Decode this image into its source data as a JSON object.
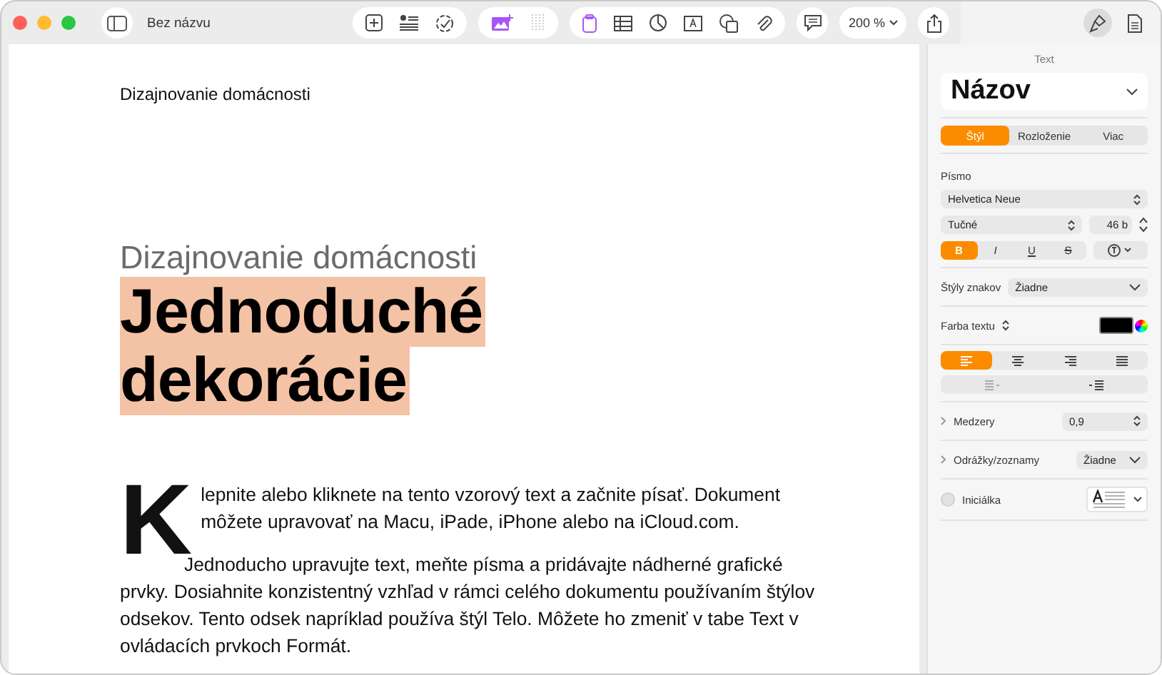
{
  "window": {
    "title": "Bez názvu"
  },
  "toolbar": {
    "zoom": "200 %",
    "inspector_tabs": [
      {
        "kind": "format",
        "selected": true
      },
      {
        "kind": "document",
        "selected": false
      }
    ]
  },
  "document": {
    "header": "Dizajnovanie domácnosti",
    "subtitle": "Dizajnovanie domácnosti",
    "title_lines": [
      "Jednoduché",
      "dekorácie"
    ],
    "drop_cap": "K",
    "paragraphs": [
      "lepnite alebo kliknete na tento vzorový text a začnite písať. Dokument môžete upravovať na Macu, iPade, iPhone alebo na iCloud.com.",
      "Jednoducho upravujte text, meňte písma a pridávajte nádherné grafické prvky. Dosiahnite konzistentný vzhľad v rámci celého dokumentu používaním štýlov odsekov. Tento odsek napríklad používa štýl Telo. Môžete ho zmeniť v tabe Text v ovládacích prvkoch Formát."
    ]
  },
  "sidebar": {
    "heading": "Text",
    "paragraph_style": "Názov",
    "tabs": [
      {
        "label": "Štýl",
        "selected": true
      },
      {
        "label": "Rozloženie",
        "selected": false
      },
      {
        "label": "Viac",
        "selected": false
      }
    ],
    "font_label": "Písmo",
    "font_family": "Helvetica Neue",
    "typeface": "Tučné",
    "size": "46 b",
    "font_styles": [
      {
        "label": "B",
        "kind": "bold",
        "selected": true
      },
      {
        "label": "I",
        "kind": "italic",
        "selected": false
      },
      {
        "label": "U",
        "kind": "underline",
        "selected": false
      },
      {
        "label": "S",
        "kind": "strike",
        "selected": false
      }
    ],
    "char_styles_label": "Štýly znakov",
    "char_styles_value": "Žiadne",
    "text_color_label": "Farba textu",
    "alignment": [
      {
        "kind": "left",
        "selected": true
      },
      {
        "kind": "center",
        "selected": false
      },
      {
        "kind": "right",
        "selected": false
      },
      {
        "kind": "justify",
        "selected": false
      }
    ],
    "spacing_label": "Medzery",
    "spacing_value": "0,9",
    "bullets_label": "Odrážky/zoznamy",
    "bullets_value": "Žiadne",
    "drop_cap_label": "Iniciálka",
    "drop_cap_checked": false
  }
}
